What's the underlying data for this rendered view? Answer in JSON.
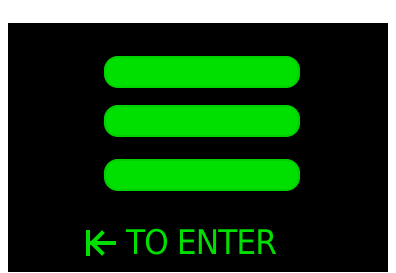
{
  "screen": {
    "background": "#000000",
    "accent": "#00e000"
  },
  "menu": {
    "icon": "hamburger-menu-icon",
    "bars": 3
  },
  "hint": {
    "icon": "enter-arrow-icon",
    "text": "TO ENTER"
  }
}
